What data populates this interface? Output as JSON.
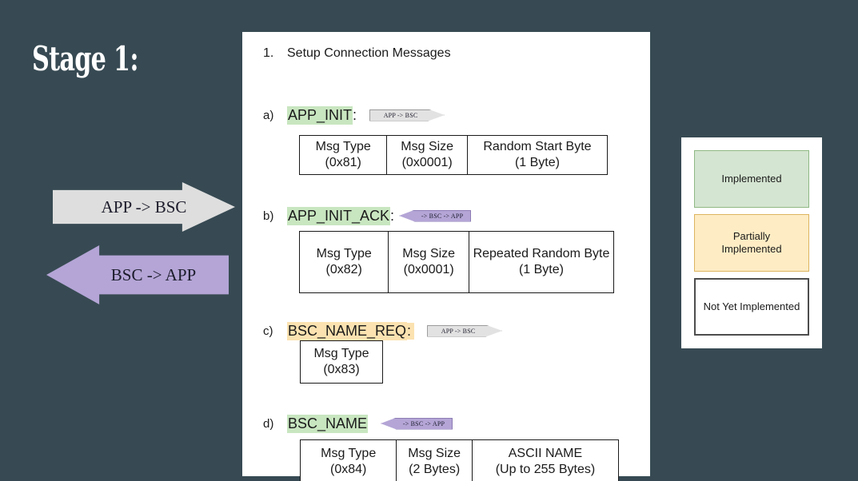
{
  "slide": {
    "title": "Stage 1:",
    "background_color": "#374a53"
  },
  "direction_legend": [
    {
      "name": "app-to-bsc-arrow",
      "label": "APP -> BSC",
      "direction": "right",
      "color": "#dedede"
    },
    {
      "name": "bsc-to-app-arrow",
      "label": "BSC -> APP",
      "direction": "left",
      "color": "#b4a5d6"
    }
  ],
  "status_legend": {
    "items": [
      {
        "label": "Implemented",
        "status": "implemented",
        "color": "#d4e5d1",
        "border": "#8fb884"
      },
      {
        "label": "Partially\nImplemented",
        "line1": "Partially",
        "line2": "Implemented",
        "status": "partial",
        "color": "#fdecc4",
        "border": "#ddb45f"
      },
      {
        "label": "Not Yet Implemented",
        "status": "not-implemented",
        "color": "#ffffff",
        "border": "#4d4d4d"
      }
    ]
  },
  "content": {
    "section_number": "1.",
    "section_title": "Setup Connection Messages",
    "messages": [
      {
        "letter": "a)",
        "name": "APP_INIT",
        "colon": ":",
        "highlight": "green",
        "badge": {
          "label": "APP -> BSC",
          "direction": "right"
        },
        "fields": [
          {
            "name": "Msg Type",
            "value": "(0x81)"
          },
          {
            "name": "Msg Size",
            "value": "(0x0001)"
          },
          {
            "name": "Random Start Byte",
            "value": "(1 Byte)"
          }
        ]
      },
      {
        "letter": "b)",
        "name": "APP_INIT_ACK",
        "colon": ":",
        "highlight": "green",
        "badge": {
          "label": "-> BSC -> APP",
          "direction": "left"
        },
        "fields": [
          {
            "name": "Msg Type",
            "value": "(0x82)"
          },
          {
            "name": "Msg Size",
            "value": "(0x0001)"
          },
          {
            "name": "Repeated Random Byte",
            "value": "(1 Byte)"
          }
        ]
      },
      {
        "letter": "c)",
        "name": "BSC_NAME_REQ",
        "colon": ":",
        "highlight": "yellow",
        "badge": {
          "label": "APP -> BSC",
          "direction": "right"
        },
        "fields": [
          {
            "name": "Msg Type",
            "value": "(0x83)"
          }
        ]
      },
      {
        "letter": "d)",
        "name": "BSC_NAME",
        "colon": "",
        "highlight": "green",
        "badge": {
          "label": "-> BSC -> APP",
          "direction": "left"
        },
        "fields": [
          {
            "name": "Msg Type",
            "value": "(0x84)"
          },
          {
            "name": "Msg Size",
            "value": "(2 Bytes)"
          },
          {
            "name": "ASCII NAME",
            "value": "(Up to 255 Bytes)"
          }
        ]
      }
    ]
  }
}
